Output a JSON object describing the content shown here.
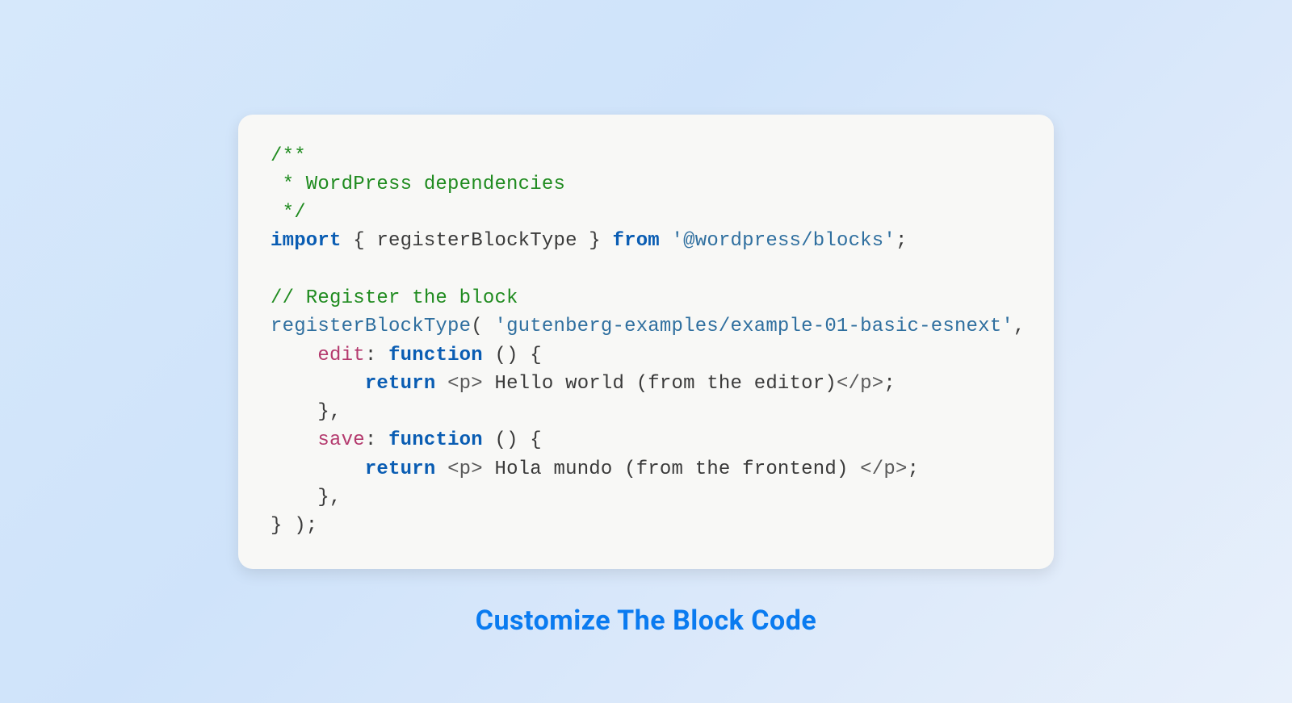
{
  "caption": "Customize The Block Code",
  "code": {
    "comment_block_open": "/**",
    "comment_block_line": " * WordPress dependencies",
    "comment_block_close": " */",
    "import_kw": "import",
    "import_brace_open": " { ",
    "import_name": "registerBlockType",
    "import_brace_close": " } ",
    "from_kw": "from",
    "import_space": " ",
    "import_module": "'@wordpress/blocks'",
    "import_semicolon": ";",
    "comment_register": "// Register the block",
    "call_name": "registerBlockType",
    "call_open": "( ",
    "block_id": "'gutenberg-examples/example-01-basic-esnext'",
    "call_comma": ",",
    "indent1": "    ",
    "edit_key": "edit",
    "colon_space": ": ",
    "function_kw": "function",
    "func_sig": " () {",
    "indent2": "        ",
    "return_kw": "return",
    "space": " ",
    "tag_open_p": "<p>",
    "edit_text": " Hello world (from the editor)",
    "tag_close_p": "</p>",
    "semicolon": ";",
    "brace_close_comma": "},",
    "save_key": "save",
    "save_text": " Hola mundo (from the frontend) ",
    "final_close": "} );"
  }
}
